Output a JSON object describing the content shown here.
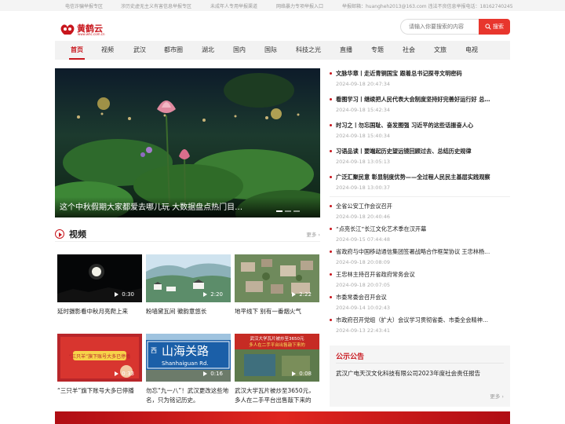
{
  "topbar": [
    "电信诈骗举报专区",
    "涉历史虚无主义有害信息举报专区",
    "未成年人专用举报渠道",
    "网络暴力专项举报入口",
    "举报邮箱：huangheh2013@163.com 违法不良信息举报电话：18162740245"
  ],
  "logo": {
    "name": "黄鹤云",
    "sub": "www.whc.com.cn"
  },
  "search": {
    "placeholder": "请输入你要搜索的内容",
    "button": "搜索"
  },
  "nav": [
    "首页",
    "视频",
    "武汉",
    "都市圈",
    "湖北",
    "国内",
    "国际",
    "科技之光",
    "直播",
    "专题",
    "社会",
    "文旅",
    "电视"
  ],
  "hero": {
    "caption": "这个中秋假期大家都爱去哪儿玩 大数据盘点热门目…"
  },
  "top_news": [
    {
      "title": "文脉华章丨走近青铜国宝 跟着总书记探寻文明密码",
      "date": "2024-09-18 20:47:34"
    },
    {
      "title": "看图学习丨继续把人民代表大会制度坚持好完善好运行好 总…",
      "date": "2024-09-18 15:42:34"
    },
    {
      "title": "时习之丨勿忘国耻、奋发图强 习近平的这些话振奋人心",
      "date": "2024-09-18 15:40:34"
    },
    {
      "title": "习语品读丨要端起历史望远镜回顾过去、总结历史规律",
      "date": "2024-09-18 13:05:13"
    },
    {
      "title": "广泛汇聚民意 彰显制度优势——全过程人民民主基层实践观察",
      "date": "2024-09-18 13:00:37"
    }
  ],
  "more_news": [
    {
      "title": "全省公安工作会议召开",
      "date": "2024-09-18 20:40:46"
    },
    {
      "title": "“点亮长江”长江文化艺术季在汉开幕",
      "date": "2024-09-15 07:44:48"
    },
    {
      "title": "省政府与中国移动通信集团签署战略合作框架协议 王忠林杨…",
      "date": "2024-09-18 20:08:09"
    },
    {
      "title": "王忠林主持召开省政府常务会议",
      "date": "2024-09-18 20:07:05"
    },
    {
      "title": "市委常委会召开会议",
      "date": "2024-09-14 10:02:43"
    },
    {
      "title": "市政府召开党组（扩大）会议学习贯彻省委、市委全会精神…",
      "date": "2024-09-13 22:43:41"
    }
  ],
  "video_section": {
    "title": "视频",
    "more": "更多 ›"
  },
  "videos": [
    {
      "title": "延时摄影看中秋月亮爬上来",
      "duration": "0:30"
    },
    {
      "title": "粉墙黛瓦间 徽韵意悠长",
      "duration": "2:20"
    },
    {
      "title": "地平线下 别有一番烟火气",
      "duration": "2:22"
    },
    {
      "title": "“三只羊”旗下账号大多已停播",
      "duration": "0:33"
    },
    {
      "title": "勿忘“九一八”！武汉更改这些地名，只为铭记历史。",
      "duration": "0:16"
    },
    {
      "title": "武汉大学瓦片被炒至3650元，多人在二手平台出售敲下来的",
      "duration": "0:08"
    }
  ],
  "thumb_text": {
    "sign_big": "山海关路",
    "sign_small": "Shanhaiguan Rd.",
    "sign_west": "西",
    "promo_line1": "“三只羊”旗下账号大多已停播",
    "whu_line1": "武汉大学瓦片被炒至3650元",
    "whu_line2": "多人在二手平台出售敲下来的"
  },
  "notice": {
    "title": "公示公告",
    "item": "武汉广电天汉文化科技有限公司2023年度社会责任报告",
    "more": "更多 ›"
  },
  "colors": {
    "brand": "#c8161d",
    "button": "#e8362d",
    "nav_bg": "#f2f2f2"
  }
}
